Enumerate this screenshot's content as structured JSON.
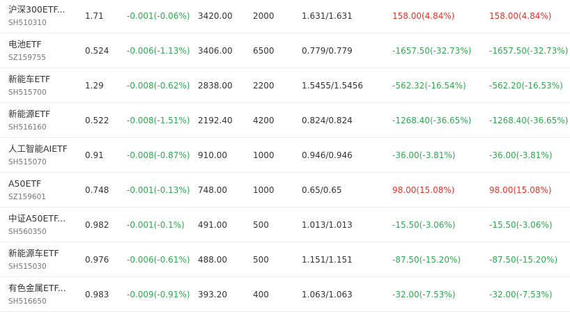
{
  "colors": {
    "up": "#e5332a",
    "down": "#2fa84f",
    "text": "#333333",
    "subtext": "#777777"
  },
  "rows": [
    {
      "name": "沪深300ETF...",
      "code": "SH510310",
      "price": "1.71",
      "change": "-0.001(-0.06%)",
      "change_dir": "down",
      "market_value": "3420.00",
      "quantity": "2000",
      "cost": "1.631/1.631",
      "pl1": "158.00(4.84%)",
      "pl1_dir": "up",
      "pl2": "158.00(4.84%)",
      "pl2_dir": "up"
    },
    {
      "name": "电池ETF",
      "code": "SZ159755",
      "price": "0.524",
      "change": "-0.006(-1.13%)",
      "change_dir": "down",
      "market_value": "3406.00",
      "quantity": "6500",
      "cost": "0.779/0.779",
      "pl1": "-1657.50(-32.73%)",
      "pl1_dir": "down",
      "pl2": "-1657.50(-32.73%)",
      "pl2_dir": "down"
    },
    {
      "name": "新能车ETF",
      "code": "SH515700",
      "price": "1.29",
      "change": "-0.008(-0.62%)",
      "change_dir": "down",
      "market_value": "2838.00",
      "quantity": "2200",
      "cost": "1.5455/1.5456",
      "pl1": "-562.32(-16.54%)",
      "pl1_dir": "down",
      "pl2": "-562.20(-16.53%)",
      "pl2_dir": "down"
    },
    {
      "name": "新能源ETF",
      "code": "SH516160",
      "price": "0.522",
      "change": "-0.008(-1.51%)",
      "change_dir": "down",
      "market_value": "2192.40",
      "quantity": "4200",
      "cost": "0.824/0.824",
      "pl1": "-1268.40(-36.65%)",
      "pl1_dir": "down",
      "pl2": "-1268.40(-36.65%)",
      "pl2_dir": "down"
    },
    {
      "name": "人工智能AIETF",
      "code": "SH515070",
      "price": "0.91",
      "change": "-0.008(-0.87%)",
      "change_dir": "down",
      "market_value": "910.00",
      "quantity": "1000",
      "cost": "0.946/0.946",
      "pl1": "-36.00(-3.81%)",
      "pl1_dir": "down",
      "pl2": "-36.00(-3.81%)",
      "pl2_dir": "down"
    },
    {
      "name": "A50ETF",
      "code": "SZ159601",
      "price": "0.748",
      "change": "-0.001(-0.13%)",
      "change_dir": "down",
      "market_value": "748.00",
      "quantity": "1000",
      "cost": "0.65/0.65",
      "pl1": "98.00(15.08%)",
      "pl1_dir": "up",
      "pl2": "98.00(15.08%)",
      "pl2_dir": "up"
    },
    {
      "name": "中证A50ETF...",
      "code": "SH560350",
      "price": "0.982",
      "change": "-0.001(-0.1%)",
      "change_dir": "down",
      "market_value": "491.00",
      "quantity": "500",
      "cost": "1.013/1.013",
      "pl1": "-15.50(-3.06%)",
      "pl1_dir": "down",
      "pl2": "-15.50(-3.06%)",
      "pl2_dir": "down"
    },
    {
      "name": "新能源车ETF",
      "code": "SH515030",
      "price": "0.976",
      "change": "-0.006(-0.61%)",
      "change_dir": "down",
      "market_value": "488.00",
      "quantity": "500",
      "cost": "1.151/1.151",
      "pl1": "-87.50(-15.20%)",
      "pl1_dir": "down",
      "pl2": "-87.50(-15.20%)",
      "pl2_dir": "down"
    },
    {
      "name": "有色金属ETF...",
      "code": "SH516650",
      "price": "0.983",
      "change": "-0.009(-0.91%)",
      "change_dir": "down",
      "market_value": "393.20",
      "quantity": "400",
      "cost": "1.063/1.063",
      "pl1": "-32.00(-7.53%)",
      "pl1_dir": "down",
      "pl2": "-32.00(-7.53%)",
      "pl2_dir": "down"
    }
  ]
}
